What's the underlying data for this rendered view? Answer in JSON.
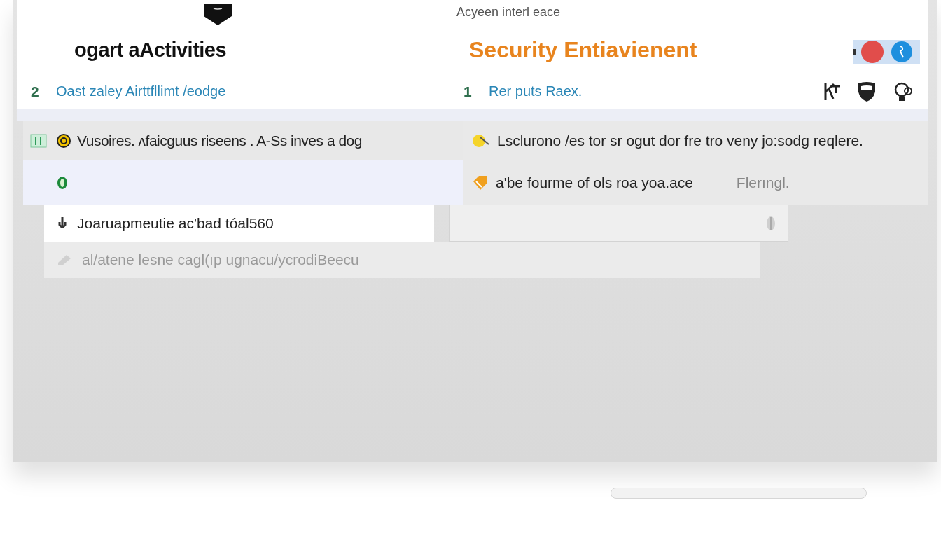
{
  "left_panel": {
    "title": "ogart aActivities",
    "item": {
      "number": "2",
      "label": "Oast zaley Airttfllimt /eodge"
    }
  },
  "right_panel": {
    "caption": "Acyeen interl eace",
    "title": "Security Entiavienent",
    "toggle": {
      "on": true
    },
    "item": {
      "number": "1",
      "label": "Rer puts Raex."
    }
  },
  "left_rows": [
    {
      "kind": "text",
      "text": "Vusoires. ʌfaicguus riseens . A-Ss inves a dog",
      "selected": false
    },
    {
      "kind": "icon",
      "selected": true
    }
  ],
  "right_rows": [
    {
      "text": "Lsclurono /es tor sr ogut dor fre tro veny jo:sodg reqlere."
    },
    {
      "text": "a'be fourme of ols roa yoa.ace",
      "note": "Flerıngl."
    }
  ],
  "entry": {
    "value": "Joaruapmeutie ac'bad tóal560"
  },
  "faded_row": {
    "text": "al/atene lesne cagl(ıp ugnacu/ycrodiBeecu",
    "disabled": true
  }
}
